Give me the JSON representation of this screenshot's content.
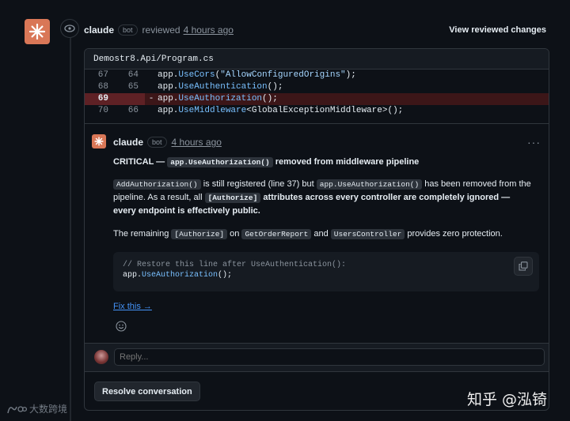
{
  "review": {
    "author": "claude",
    "badge": "bot",
    "action": "reviewed",
    "time": "4 hours ago",
    "view_changes": "View reviewed changes"
  },
  "file": {
    "path": "Demostr8.Api/Program.cs",
    "lines": [
      {
        "old": "67",
        "new": "64",
        "sign": "",
        "code_pre": "app.",
        "code_kw": "UseCors",
        "code_post": "(",
        "code_str": "\"AllowConfiguredOrigins\"",
        "code_end": ");",
        "deleted": false
      },
      {
        "old": "68",
        "new": "65",
        "sign": "",
        "code_pre": "app.",
        "code_kw": "UseAuthentication",
        "code_post": "();",
        "code_str": "",
        "code_end": "",
        "deleted": false
      },
      {
        "old": "69",
        "new": "",
        "sign": "-",
        "code_pre": "app.",
        "code_kw": "UseAuthorization",
        "code_post": "();",
        "code_str": "",
        "code_end": "",
        "deleted": true
      },
      {
        "old": "70",
        "new": "66",
        "sign": "",
        "code_pre": "app.",
        "code_kw": "UseMiddleware",
        "code_post": "<GlobalExceptionMiddleware>();",
        "code_str": "",
        "code_end": "",
        "deleted": false
      }
    ]
  },
  "comment": {
    "author": "claude",
    "badge": "bot",
    "time": "4 hours ago",
    "menu": "···",
    "title_prefix": "CRITICAL —",
    "title_code": "app.UseAuthorization()",
    "title_suffix": "removed from middleware pipeline",
    "p1_code1": "AddAuthorization()",
    "p1_text1": "is still registered (line 37) but",
    "p1_code2": "app.UseAuthorization()",
    "p1_text2": "has been removed from the pipeline. As a result, all",
    "p1_code3": "[Authorize]",
    "p1_text3": "attributes across every controller are completely ignored — every endpoint is effectively public.",
    "p2_text1": "The remaining",
    "p2_code1": "[Authorize]",
    "p2_text2": "on",
    "p2_code2": "GetOrderReport",
    "p2_text3": "and",
    "p2_code3": "UsersController",
    "p2_text4": "provides zero protection.",
    "snippet_comment": "// Restore this line after UseAuthentication():",
    "snippet_pre": "app.",
    "snippet_kw": "UseAuthorization",
    "snippet_post": "();",
    "fix_link": "Fix this →"
  },
  "reply": {
    "placeholder": "Reply..."
  },
  "resolve_label": "Resolve conversation",
  "watermarks": {
    "left": "大数跨境",
    "right": "知乎 @泓锜"
  },
  "colors": {
    "accent": "#d97757",
    "link": "#4493f8",
    "deleted_bg": "#3c1618"
  }
}
